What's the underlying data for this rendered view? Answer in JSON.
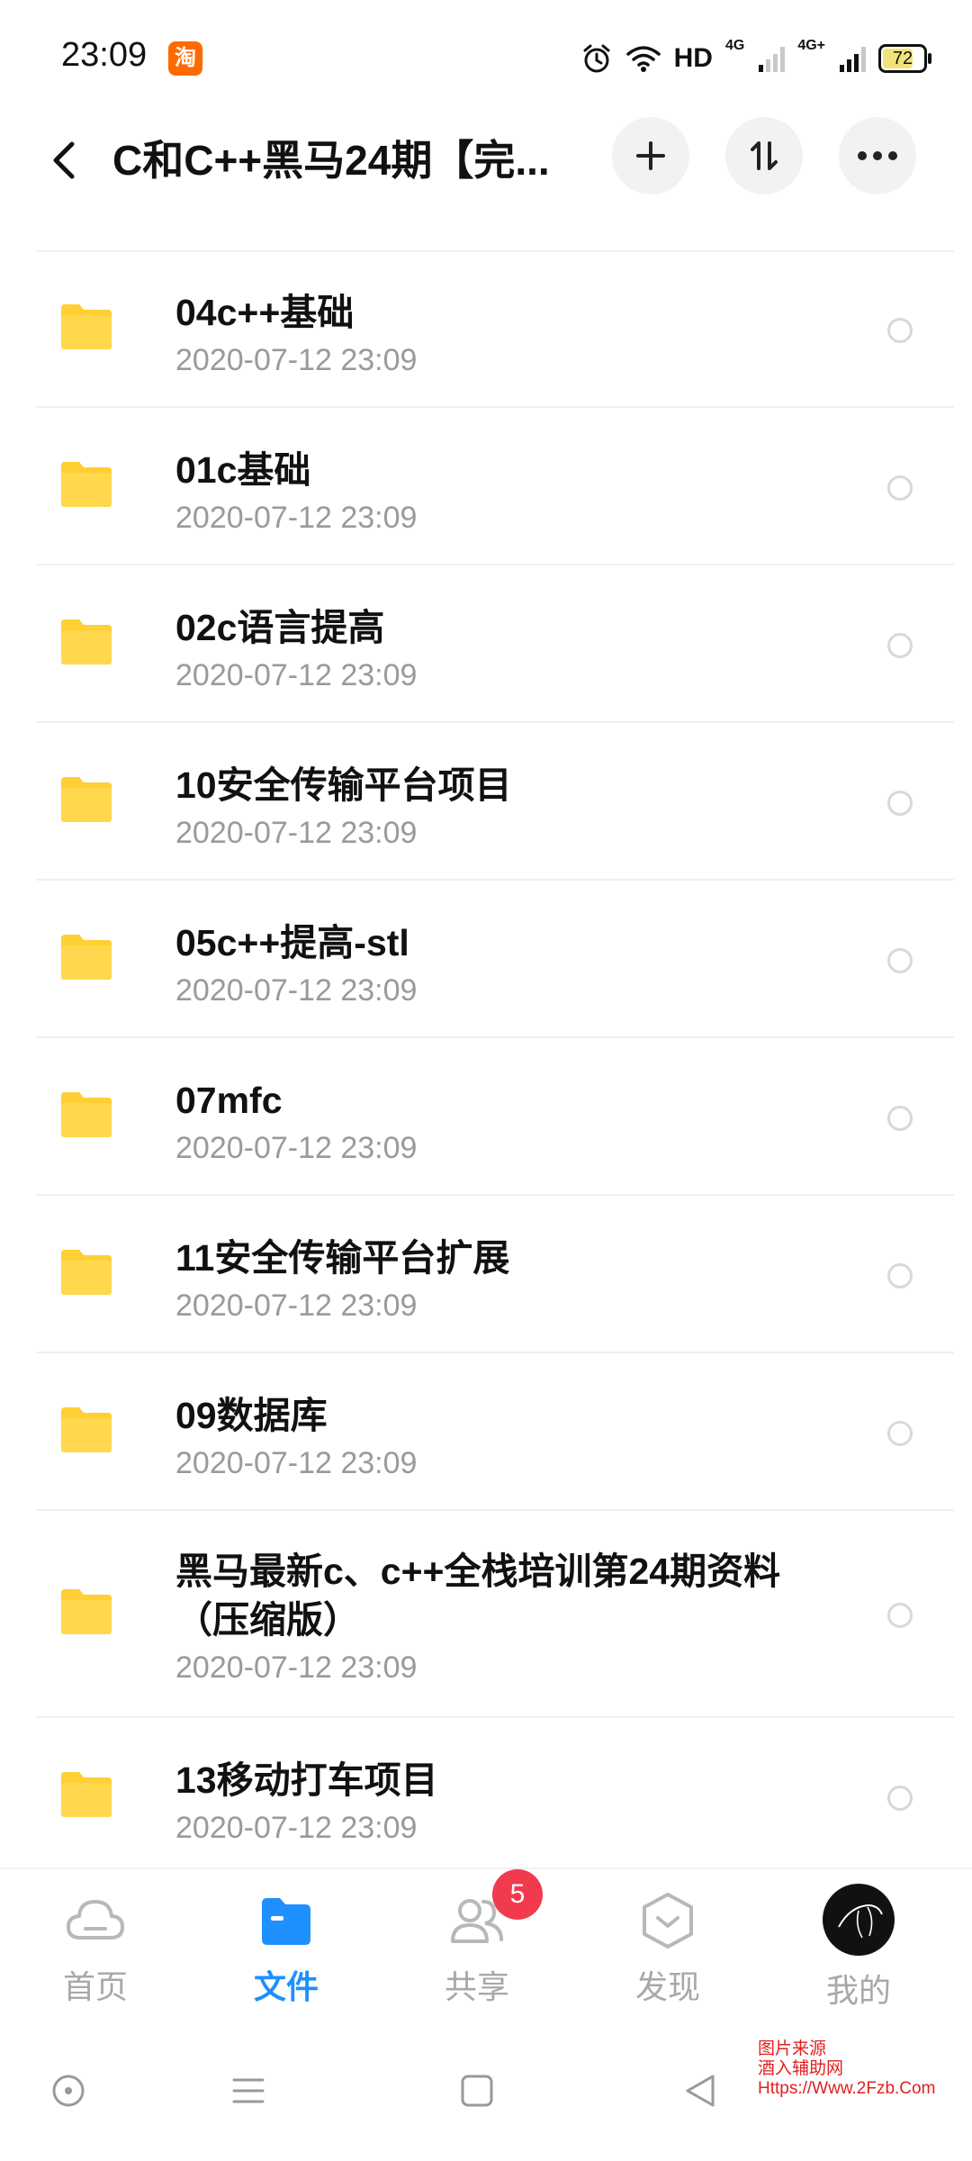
{
  "status_bar": {
    "time": "23:09",
    "app_badge": "淘",
    "network": "HD",
    "sim1": "4G",
    "sim2": "4G+",
    "battery": "72",
    "battery_level": 0.72
  },
  "header": {
    "title": "C和C++黑马24期【完...",
    "icons": [
      "back-arrow-icon",
      "plus-icon",
      "sort-icon",
      "more-icon"
    ]
  },
  "files": [
    {
      "name": "04c++基础",
      "date": "2020-07-12  23:09"
    },
    {
      "name": "01c基础",
      "date": "2020-07-12  23:09"
    },
    {
      "name": "02c语言提高",
      "date": "2020-07-12  23:09"
    },
    {
      "name": "10安全传输平台项目",
      "date": "2020-07-12  23:09"
    },
    {
      "name": "05c++提高-stl",
      "date": "2020-07-12  23:09"
    },
    {
      "name": "07mfc",
      "date": "2020-07-12  23:09"
    },
    {
      "name": "11安全传输平台扩展",
      "date": "2020-07-12  23:09"
    },
    {
      "name": "09数据库",
      "date": "2020-07-12  23:09"
    },
    {
      "name": "黑马最新c、c++全栈培训第24期资料（压缩版）",
      "date": "2020-07-12  23:09"
    },
    {
      "name": "13移动打车项目",
      "date": "2020-07-12  23:09"
    }
  ],
  "bottom_nav": {
    "tabs": [
      {
        "label": "首页",
        "icon": "cloud-icon"
      },
      {
        "label": "文件",
        "icon": "folder-icon"
      },
      {
        "label": "共享",
        "icon": "people-icon",
        "badge": "5"
      },
      {
        "label": "发现",
        "icon": "discover-icon"
      },
      {
        "label": "我的",
        "icon": "avatar-icon"
      }
    ],
    "active": "文件"
  },
  "watermark": {
    "line1": "图片来源",
    "line2": "酒入辅助网",
    "line3": "Https://Www.2Fzb.Com"
  },
  "colors": {
    "accent": "#1e90ff",
    "folder": "#ffcf33",
    "badge": "#f23a4e"
  }
}
